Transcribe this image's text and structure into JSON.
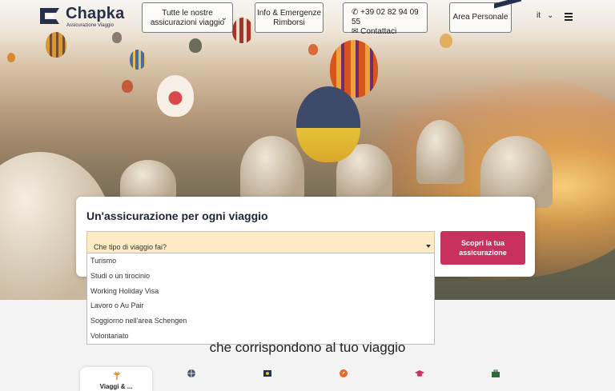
{
  "brand": {
    "name": "Chapka",
    "tagline": "Assicurazione Viaggio"
  },
  "nav": {
    "insurances_label": "Tutte le nostre assicurazioni viaggio",
    "info_label": "Info & Emergenze Rimborsi",
    "phone": "+39 02 82 94 09 55",
    "contacts_label": "Contattaci",
    "account_label": "Area Personale",
    "language": "it"
  },
  "hero_card": {
    "title": "Un'assicurazione per ogni viaggio",
    "select_placeholder": "Che tipo di viaggio fai?",
    "cta_label": "Scopri la tua assicurazione"
  },
  "trip_options": [
    "Turismo",
    "Studi o un tirocinio",
    "Working Holiday Visa",
    "Lavoro o Au Pair",
    "Soggiorno nell'area Schengen",
    "Volontariato"
  ],
  "section": {
    "subtitle": "che corrispondono al tuo viaggio",
    "active_tab": "Viaggi & ..."
  },
  "colors": {
    "primary": "#26304a",
    "accent": "#c8315e",
    "select_bg": "#fcebc4",
    "tab_icon": "#e38b2c"
  },
  "icons": [
    "palm-icon",
    "globe-icon",
    "flag-icon",
    "compass-icon",
    "graduation-icon",
    "briefcase-icon"
  ]
}
